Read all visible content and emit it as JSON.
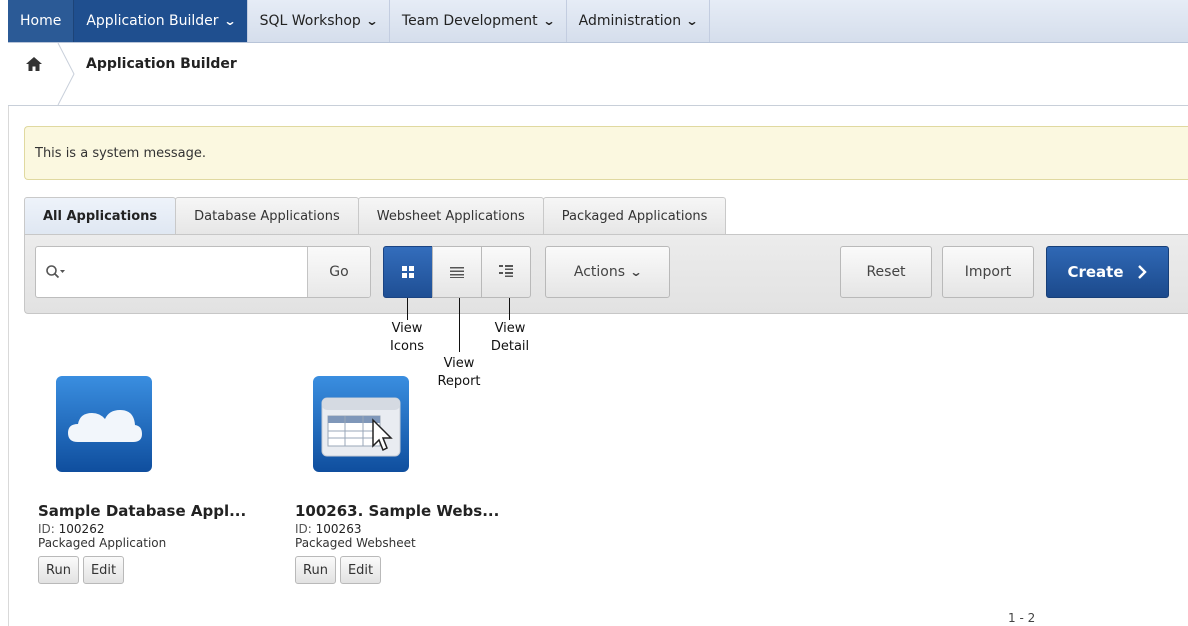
{
  "topnav": {
    "home": "Home",
    "app_builder": "Application Builder",
    "sql_workshop": "SQL Workshop",
    "team_dev": "Team Development",
    "administration": "Administration"
  },
  "breadcrumb": {
    "title": "Application Builder"
  },
  "system_message": "This is a system message.",
  "tabs": [
    "All Applications",
    "Database Applications",
    "Websheet Applications",
    "Packaged Applications"
  ],
  "toolbar": {
    "search_placeholder": "",
    "go": "Go",
    "actions": "Actions",
    "reset": "Reset",
    "import": "Import",
    "create": "Create"
  },
  "annotations": {
    "view_icons": "View\nIcons",
    "view_report": "View\nReport",
    "view_detail": "View\nDetail"
  },
  "apps": [
    {
      "name": "Sample Database Appl...",
      "id_label": "ID:",
      "id": "100262",
      "type": "Packaged Application",
      "run": "Run",
      "edit": "Edit"
    },
    {
      "name": "100263. Sample Webs...",
      "id_label": "ID:",
      "id": "100263",
      "type": "Packaged Websheet",
      "run": "Run",
      "edit": "Edit"
    }
  ],
  "pager": "1 - 2",
  "colors": {
    "brand_blue": "#1f4f8f",
    "create_blue": "#2f68b5",
    "message_bg": "#fbf8e0"
  }
}
